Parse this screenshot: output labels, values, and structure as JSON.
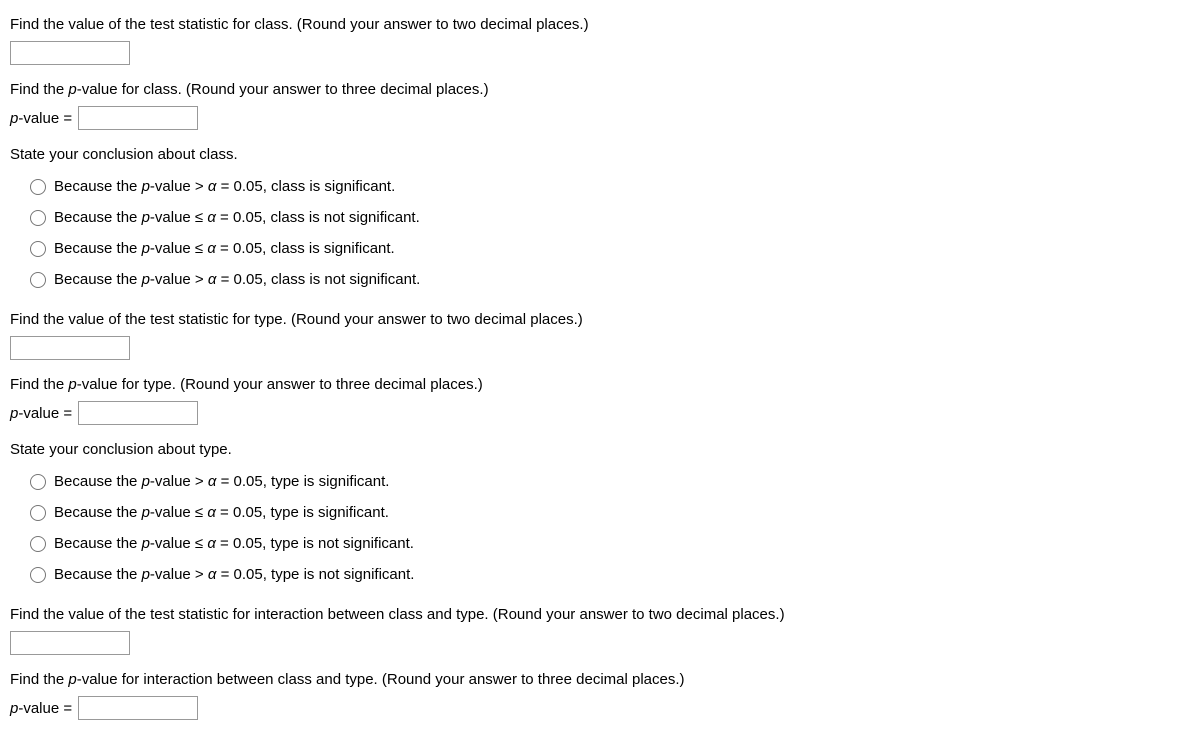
{
  "q1": {
    "prompt": "Find the value of the test statistic for class. (Round your answer to two decimal places.)"
  },
  "q2": {
    "prompt_before": "Find the ",
    "prompt_italic": "p",
    "prompt_after": "-value for class. (Round your answer to three decimal places.)",
    "label_italic": "p",
    "label_after": "-value = "
  },
  "q3": {
    "prompt": "State your conclusion about class.",
    "options": [
      {
        "pre": "Because the ",
        "it": "p",
        "mid": "-value > ",
        "gk": "α",
        "post": " = 0.05, class is significant."
      },
      {
        "pre": "Because the ",
        "it": "p",
        "mid": "-value ≤ ",
        "gk": "α",
        "post": " = 0.05, class is not significant."
      },
      {
        "pre": "Because the ",
        "it": "p",
        "mid": "-value ≤ ",
        "gk": "α",
        "post": " = 0.05, class is significant."
      },
      {
        "pre": "Because the ",
        "it": "p",
        "mid": "-value > ",
        "gk": "α",
        "post": " = 0.05, class is not significant."
      }
    ]
  },
  "q4": {
    "prompt": "Find the value of the test statistic for type. (Round your answer to two decimal places.)"
  },
  "q5": {
    "prompt_before": "Find the ",
    "prompt_italic": "p",
    "prompt_after": "-value for type. (Round your answer to three decimal places.)",
    "label_italic": "p",
    "label_after": "-value = "
  },
  "q6": {
    "prompt": "State your conclusion about type.",
    "options": [
      {
        "pre": "Because the ",
        "it": "p",
        "mid": "-value > ",
        "gk": "α",
        "post": " = 0.05, type is significant."
      },
      {
        "pre": "Because the ",
        "it": "p",
        "mid": "-value ≤ ",
        "gk": "α",
        "post": " = 0.05, type is significant."
      },
      {
        "pre": "Because the ",
        "it": "p",
        "mid": "-value ≤ ",
        "gk": "α",
        "post": " = 0.05, type is not significant."
      },
      {
        "pre": "Because the ",
        "it": "p",
        "mid": "-value > ",
        "gk": "α",
        "post": " = 0.05, type is not significant."
      }
    ]
  },
  "q7": {
    "prompt": "Find the value of the test statistic for interaction between class and type. (Round your answer to two decimal places.)"
  },
  "q8": {
    "prompt_before": "Find the ",
    "prompt_italic": "p",
    "prompt_after": "-value for interaction between class and type. (Round your answer to three decimal places.)",
    "label_italic": "p",
    "label_after": "-value = "
  }
}
